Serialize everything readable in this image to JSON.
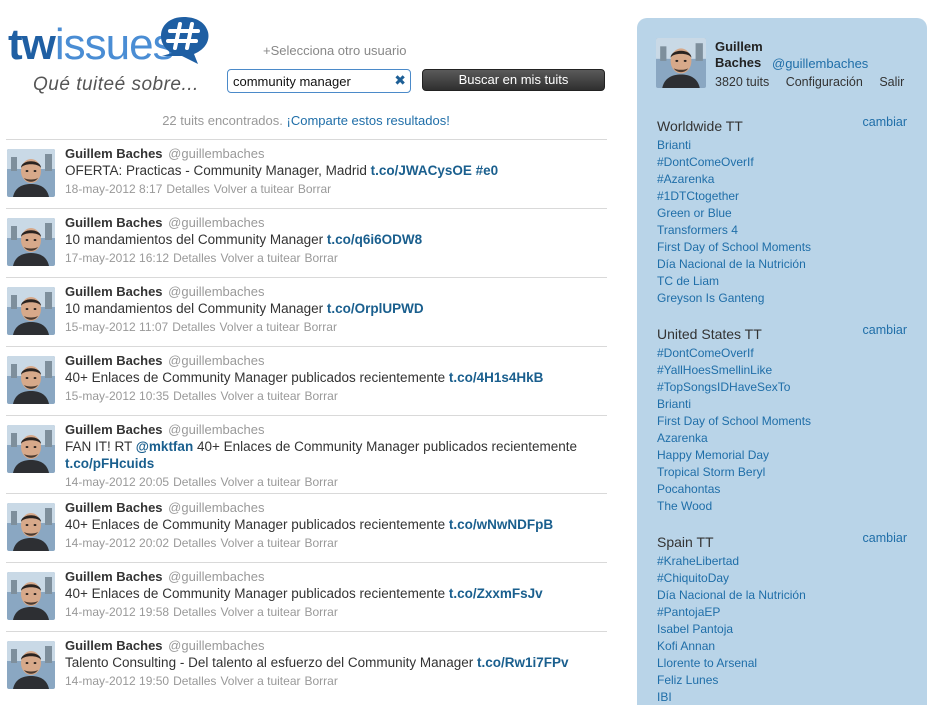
{
  "header": {
    "logo_tw": "tw",
    "logo_issues": "issues",
    "tagline": "Qué tuiteé sobre...",
    "select_user": "+Selecciona otro usuario",
    "search_value": "community manager",
    "search_button": "Buscar en mis tuits",
    "results_count": "22 tuits encontrados.",
    "share_results": "¡Comparte estos resultados!"
  },
  "actions": {
    "details": "Detalles",
    "retweet": "Volver a tuitear",
    "delete": "Borrar"
  },
  "tweets": [
    {
      "name": "Guillem Baches",
      "handle": "@guillembaches",
      "text": "OFERTA: Practicas - Community Manager, Madrid ",
      "link": "t.co/JWACysOE #e0",
      "date": "18-may-2012 8:17"
    },
    {
      "name": "Guillem Baches",
      "handle": "@guillembaches",
      "text": "10 mandamientos del Community Manager ",
      "link": "t.co/q6i6ODW8",
      "date": "17-may-2012 16:12"
    },
    {
      "name": "Guillem Baches",
      "handle": "@guillembaches",
      "text": "10 mandamientos del Community Manager ",
      "link": "t.co/OrplUPWD",
      "date": "15-may-2012 11:07"
    },
    {
      "name": "Guillem Baches",
      "handle": "@guillembaches",
      "text": "40+ Enlaces de Community Manager publicados recientemente ",
      "link": "t.co/4H1s4HkB",
      "date": "15-may-2012 10:35"
    },
    {
      "name": "Guillem Baches",
      "handle": "@guillembaches",
      "text_pre": "FAN IT! RT ",
      "mention": "@mktfan",
      "text": " 40+ Enlaces de Community Manager publicados recientemente ",
      "link": "t.co/pFHcuids",
      "date": "14-may-2012 20:05"
    },
    {
      "name": "Guillem Baches",
      "handle": "@guillembaches",
      "text": "40+ Enlaces de Community Manager publicados recientemente ",
      "link": "t.co/wNwNDFpB",
      "date": "14-may-2012 20:02"
    },
    {
      "name": "Guillem Baches",
      "handle": "@guillembaches",
      "text": "40+ Enlaces de Community Manager publicados recientemente ",
      "link": "t.co/ZxxmFsJv",
      "date": "14-may-2012 19:58"
    },
    {
      "name": "Guillem Baches",
      "handle": "@guillembaches",
      "text": "Talento Consulting - Del talento al esfuerzo del Community Manager ",
      "link": "t.co/Rw1i7FPv",
      "date": "14-may-2012 19:50"
    }
  ],
  "profile": {
    "name": "Guillem Baches",
    "handle": "@guillembaches",
    "tweets": "3820 tuits",
    "settings": "Configuración",
    "logout": "Salir"
  },
  "trends": [
    {
      "title": "Worldwide TT",
      "change": "cambiar",
      "items": [
        "Brianti",
        "#DontComeOverIf",
        "#Azarenka",
        "#1DTCtogether",
        "Green or Blue",
        "Transformers 4",
        "First Day of School Moments",
        "Día Nacional de la Nutrición",
        "TC de Liam",
        "Greyson Is Ganteng"
      ]
    },
    {
      "title": "United States TT",
      "change": "cambiar",
      "items": [
        "#DontComeOverIf",
        "#YallHoesSmellinLike",
        "#TopSongsIDHaveSexTo",
        "Brianti",
        "First Day of School Moments",
        "Azarenka",
        "Happy Memorial Day",
        "Tropical Storm Beryl",
        "Pocahontas",
        "The Wood"
      ]
    },
    {
      "title": "Spain TT",
      "change": "cambiar",
      "items": [
        "#KraheLibertad",
        "#ChiquitoDay",
        "Día Nacional de la Nutrición",
        "#PantojaEP",
        "Isabel Pantoja",
        "Kofi Annan",
        "Llorente to Arsenal",
        "Feliz Lunes",
        "IBI"
      ]
    }
  ],
  "colors": {
    "link": "#1f6ea8",
    "sidebar_bg": "#b9d4e8",
    "logo_dark": "#1f5fa3",
    "logo_light": "#4a8dd4"
  }
}
